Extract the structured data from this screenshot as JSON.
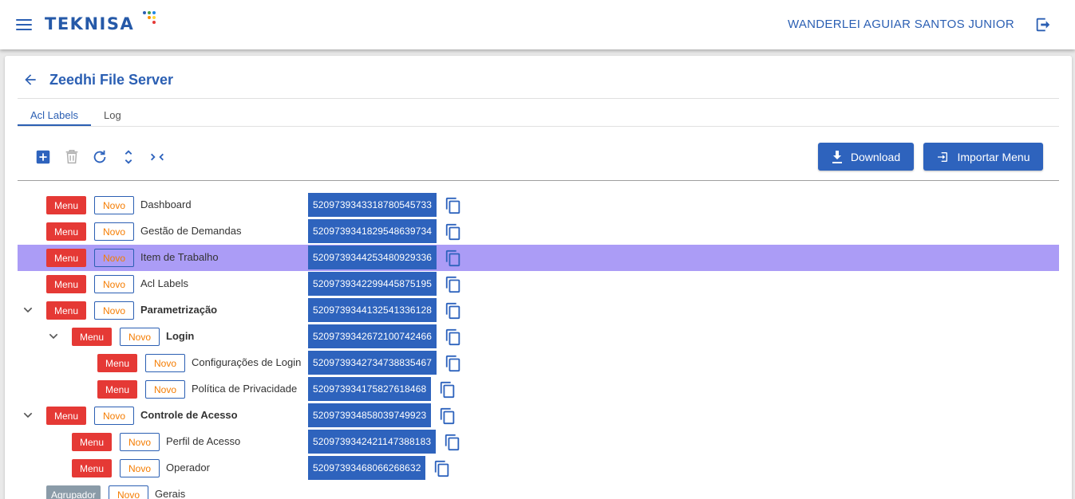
{
  "header": {
    "logo": "TEKNISA",
    "user": "WANDERLEI AGUIAR SANTOS JUNIOR"
  },
  "page": {
    "title": "Zeedhi File Server",
    "tabs": [
      {
        "label": "Acl Labels",
        "active": true
      },
      {
        "label": "Log",
        "active": false
      }
    ]
  },
  "toolbar": {
    "icons": [
      "add-box-icon",
      "delete-icon",
      "refresh-icon",
      "expand-all-icon",
      "collapse-all-icon"
    ],
    "download_label": "Download",
    "import_label": "Importar Menu"
  },
  "colors": {
    "primary": "#2e63bd",
    "menu_badge": "#e53935",
    "novo_text": "#f57c00",
    "selected_row": "#ab9cf6",
    "group_badge": "#8a9ba8"
  },
  "tree": [
    {
      "badge": "Menu",
      "status": "Novo",
      "label": "Dashboard",
      "id": "5209739343318780545733",
      "level": 0,
      "expandable": false,
      "bold": false,
      "selected": false
    },
    {
      "badge": "Menu",
      "status": "Novo",
      "label": "Gestão de Demandas",
      "id": "5209739341829548639734",
      "level": 0,
      "expandable": false,
      "bold": false,
      "selected": false
    },
    {
      "badge": "Menu",
      "status": "Novo",
      "label": "Item de Trabalho",
      "id": "5209739344253480929336",
      "level": 0,
      "expandable": false,
      "bold": false,
      "selected": true
    },
    {
      "badge": "Menu",
      "status": "Novo",
      "label": "Acl Labels",
      "id": "5209739342299445875195",
      "level": 0,
      "expandable": false,
      "bold": false,
      "selected": false
    },
    {
      "badge": "Menu",
      "status": "Novo",
      "label": "Parametrização",
      "id": "5209739344132541336128",
      "level": 0,
      "expandable": true,
      "bold": true,
      "selected": false
    },
    {
      "badge": "Menu",
      "status": "Novo",
      "label": "Login",
      "id": "5209739342672100742466",
      "level": 1,
      "expandable": true,
      "bold": true,
      "selected": false
    },
    {
      "badge": "Menu",
      "status": "Novo",
      "label": "Configurações de Login",
      "id": "5209739342734738835467",
      "level": 2,
      "expandable": false,
      "bold": false,
      "selected": false
    },
    {
      "badge": "Menu",
      "status": "Novo",
      "label": "Política de Privacidade",
      "id": "520973934175827618468",
      "level": 2,
      "expandable": false,
      "bold": false,
      "selected": false
    },
    {
      "badge": "Menu",
      "status": "Novo",
      "label": "Controle de Acesso",
      "id": "520973934858039749923",
      "level": 0,
      "expandable": true,
      "bold": true,
      "selected": false
    },
    {
      "badge": "Menu",
      "status": "Novo",
      "label": "Perfil de Acesso",
      "id": "5209739342421147388183",
      "level": 1,
      "expandable": false,
      "bold": false,
      "selected": false
    },
    {
      "badge": "Menu",
      "status": "Novo",
      "label": "Operador",
      "id": "520973934680662686​32",
      "level": 1,
      "expandable": false,
      "bold": false,
      "selected": false
    },
    {
      "badge": "Agrupador",
      "status": "Novo",
      "label": "Gerais",
      "id": "",
      "level": 0,
      "expandable": false,
      "bold": false,
      "selected": false
    }
  ]
}
